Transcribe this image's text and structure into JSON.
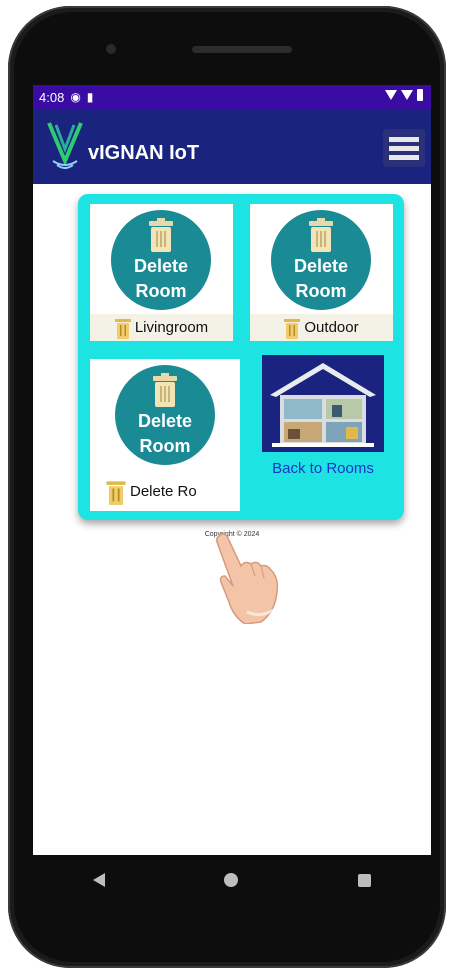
{
  "status": {
    "time": "4:08"
  },
  "app": {
    "title": "vIGNAN IoT"
  },
  "cards": [
    {
      "button_line1": "Delete",
      "button_line2": "Room",
      "room_name": "Livingroom"
    },
    {
      "button_line1": "Delete",
      "button_line2": "Room",
      "room_name": "Outdoor"
    },
    {
      "button_line1": "Delete",
      "button_line2": "Room",
      "room_name": "Delete Ro"
    }
  ],
  "back": {
    "label": "Back to Rooms"
  },
  "footer": {
    "copyright": "Copyright © 2024"
  },
  "colors": {
    "status_bar": "#3a0ca3",
    "app_bar": "#1a237e",
    "panel": "#1ee3e3",
    "circle": "#1a8a95",
    "link": "#1b33c9"
  },
  "icons": [
    "trash-icon",
    "menu-icon",
    "house-icon",
    "hand-pointer-icon"
  ]
}
